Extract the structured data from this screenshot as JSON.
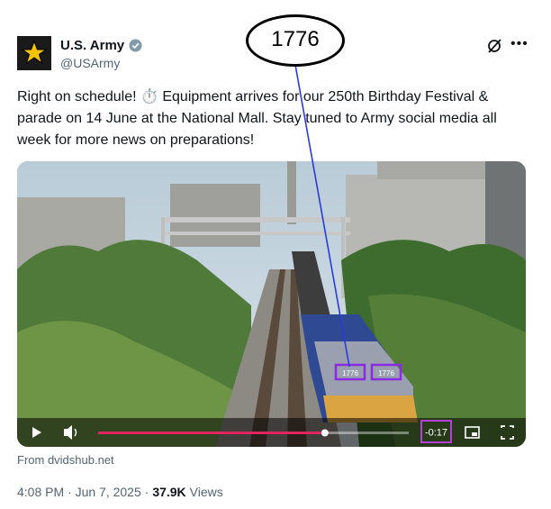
{
  "tweet": {
    "name": "U.S. Army",
    "handle": "@USArmy",
    "text": "Right on schedule! ⏱️ Equipment arrives for our 250th Birthday Festival & parade on 14 June at the National Mall. Stay tuned to Army social media all week for more news on preparations!",
    "source": "From dvidshub.net",
    "timestamp": "4:08 PM · Jun 7, 2025 · ",
    "views_count": "37.9K",
    "views_label": "Views"
  },
  "annotation": {
    "label": "1776",
    "plate_left": "1776",
    "plate_right": "1776"
  },
  "video": {
    "time_remaining": "-0:17",
    "progress": 0.73,
    "buffered": 1.0
  },
  "colors": {
    "progress": "#e0245e",
    "annotation_line": "#2b3ad6",
    "highlight_box": "#8a2be2"
  },
  "icons": [
    "star-logo-icon",
    "verified-badge-icon",
    "grok-icon",
    "more-icon",
    "play-icon",
    "volume-icon",
    "pip-icon",
    "fullscreen-icon"
  ]
}
